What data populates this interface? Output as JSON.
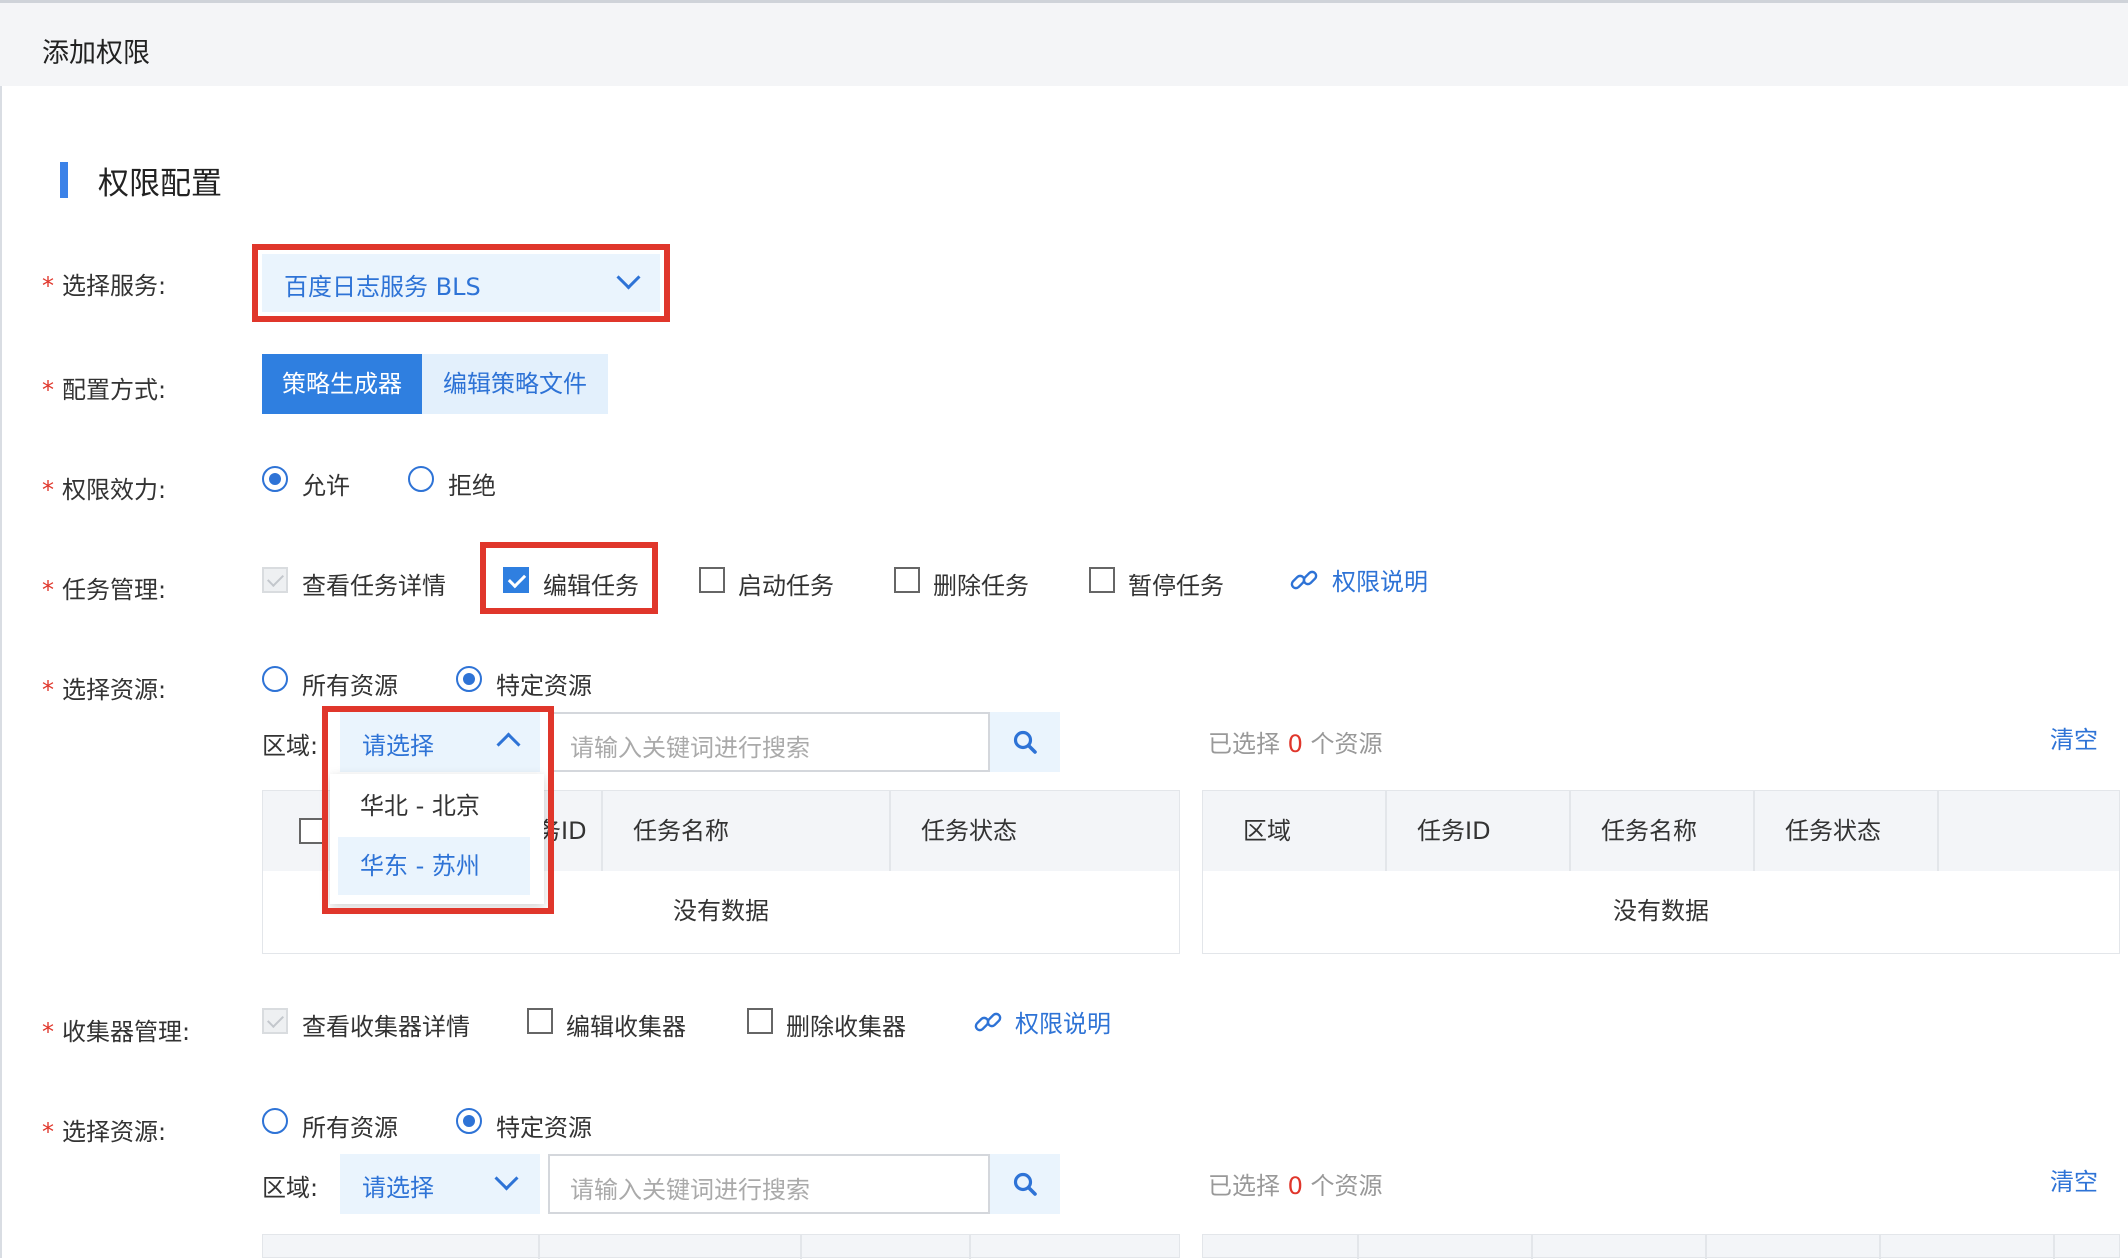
{
  "window_title": "添加权限",
  "section_title": "权限配置",
  "required_mark": "*",
  "colors": {
    "accent": "#2f7fe0",
    "required": "#e0362b",
    "highlight_box": "#e0362b"
  },
  "service": {
    "label": "选择服务:",
    "value": "百度日志服务 BLS"
  },
  "config_mode": {
    "label": "配置方式:",
    "options": [
      "策略生成器",
      "编辑策略文件"
    ],
    "selected": "策略生成器"
  },
  "effect": {
    "label": "权限效力:",
    "options": [
      "允许",
      "拒绝"
    ],
    "selected": "允许"
  },
  "task_mgmt": {
    "label": "任务管理:",
    "items": [
      {
        "label": "查看任务详情",
        "state": "checked-disabled"
      },
      {
        "label": "编辑任务",
        "state": "checked"
      },
      {
        "label": "启动任务",
        "state": "unchecked"
      },
      {
        "label": "删除任务",
        "state": "unchecked"
      },
      {
        "label": "暂停任务",
        "state": "unchecked"
      }
    ],
    "help_link": "权限说明",
    "help_icon": "link-icon"
  },
  "resource1": {
    "label": "选择资源:",
    "options": [
      "所有资源",
      "特定资源"
    ],
    "selected": "特定资源",
    "region_label": "区域:",
    "region_placeholder": "请选择",
    "region_dropdown_open": true,
    "region_options": [
      "华北 - 北京",
      "华东 - 苏州"
    ],
    "region_hovered": "华东 - 苏州",
    "search_placeholder": "请输入关键词进行搜索",
    "search_icon": "search-icon",
    "selected_prefix": "已选择 ",
    "selected_count": "0",
    "selected_suffix": " 个资源",
    "clear": "清空",
    "left_table": {
      "columns": [
        "任务ID",
        "任务名称",
        "任务状态"
      ],
      "empty": "没有数据"
    },
    "right_table": {
      "columns": [
        "区域",
        "任务ID",
        "任务名称",
        "任务状态"
      ],
      "empty": "没有数据"
    }
  },
  "collector_mgmt": {
    "label": "收集器管理:",
    "items": [
      {
        "label": "查看收集器详情",
        "state": "checked-disabled"
      },
      {
        "label": "编辑收集器",
        "state": "unchecked"
      },
      {
        "label": "删除收集器",
        "state": "unchecked"
      }
    ],
    "help_link": "权限说明",
    "help_icon": "link-icon"
  },
  "resource2": {
    "label": "选择资源:",
    "options": [
      "所有资源",
      "特定资源"
    ],
    "selected": "特定资源",
    "region_label": "区域:",
    "region_placeholder": "请选择",
    "search_placeholder": "请输入关键词进行搜索",
    "search_icon": "search-icon",
    "selected_prefix": "已选择 ",
    "selected_count": "0",
    "selected_suffix": " 个资源",
    "clear": "清空"
  }
}
